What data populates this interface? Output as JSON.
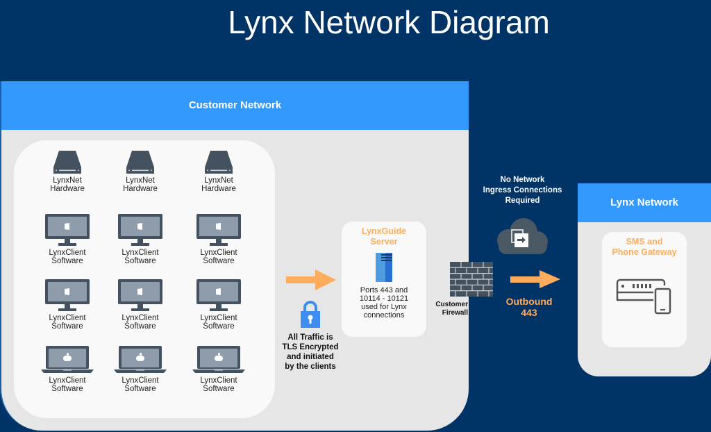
{
  "title": "Lynx Network Diagram",
  "colors": {
    "background": "#003366",
    "header_blue": "#3399ff",
    "panel_gray": "#e6e6e6",
    "card_white": "#f9f9f9",
    "accent_orange": "#ffad5c",
    "icon_slate": "#44525f"
  },
  "customer_network": {
    "label": "Customer Network",
    "devices": [
      {
        "icon": "server-drive-icon",
        "line1": "LynxNet",
        "line2": "Hardware"
      },
      {
        "icon": "server-drive-icon",
        "line1": "LynxNet",
        "line2": "Hardware"
      },
      {
        "icon": "server-drive-icon",
        "line1": "LynxNet",
        "line2": "Hardware"
      },
      {
        "icon": "windows-monitor-icon",
        "line1": "LynxClient",
        "line2": "Software"
      },
      {
        "icon": "windows-monitor-icon",
        "line1": "LynxClient",
        "line2": "Software"
      },
      {
        "icon": "windows-monitor-icon",
        "line1": "LynxClient",
        "line2": "Software"
      },
      {
        "icon": "windows-monitor-icon",
        "line1": "LynxClient",
        "line2": "Software"
      },
      {
        "icon": "windows-monitor-icon",
        "line1": "LynxClient",
        "line2": "Software"
      },
      {
        "icon": "windows-monitor-icon",
        "line1": "LynxClient",
        "line2": "Software"
      },
      {
        "icon": "mac-laptop-icon",
        "line1": "LynxClient",
        "line2": "Software"
      },
      {
        "icon": "mac-laptop-icon",
        "line1": "LynxClient",
        "line2": "Software"
      },
      {
        "icon": "mac-laptop-icon",
        "line1": "LynxClient",
        "line2": "Software"
      }
    ],
    "tls_note": [
      "All Traffic is",
      "TLS Encrypted",
      "and initiated",
      "by the clients"
    ],
    "guide_server": {
      "title": [
        "LynxGuide",
        "Server"
      ],
      "ports": [
        "Ports 443 and",
        "10114 - 10121",
        "used for Lynx",
        "connections"
      ]
    },
    "firewall_label": [
      "Customer",
      "Firewall"
    ]
  },
  "ingress_note": [
    "No Network",
    "Ingress Connections",
    "Required"
  ],
  "outbound": [
    "Outbound",
    "443"
  ],
  "lynx_network": {
    "label": "Lynx Network",
    "gateway_title": [
      "SMS and",
      "Phone Gateway"
    ]
  }
}
